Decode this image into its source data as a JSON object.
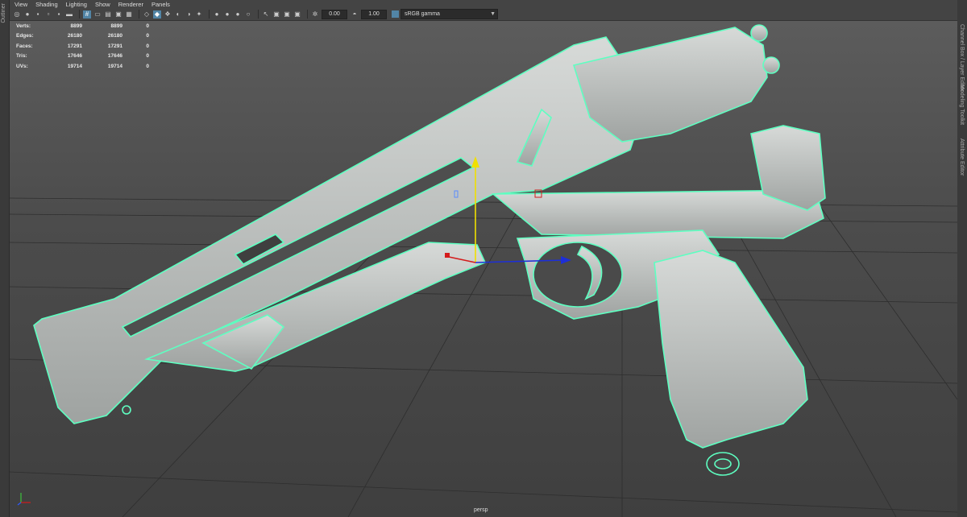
{
  "outliner_label": "Outliner",
  "menubar": [
    "View",
    "Shading",
    "Lighting",
    "Show",
    "Renderer",
    "Panels"
  ],
  "toolbar": {
    "icons": [
      "camera-select-icon",
      "camera-attributes-icon",
      "bookmark-icon",
      "image-plane-icon",
      "grid-icon",
      "film-gate-icon",
      "resolution-gate-icon",
      "gate-mask-icon",
      "field-chart-icon",
      "safe-action-icon",
      "wireframe-icon",
      "smooth-shade-icon",
      "shaded-wireframe-icon",
      "flat-shade-icon",
      "bounding-box-icon",
      "use-lights-icon",
      "shadows-icon",
      "ambient-occlusion-icon",
      "motion-blur-icon",
      "anti-alias-icon",
      "xray-icon",
      "xray-active-icon",
      "xray-joints-icon",
      "isolate-select-icon",
      "exposure-icon"
    ],
    "exposure_value": "0.00",
    "gamma_value": "1.00",
    "color_space": "sRGB gamma"
  },
  "hud": {
    "rows": [
      {
        "label": "Verts:",
        "v1": "8899",
        "v2": "8899",
        "v3": "0"
      },
      {
        "label": "Edges:",
        "v1": "26180",
        "v2": "26180",
        "v3": "0"
      },
      {
        "label": "Faces:",
        "v1": "17291",
        "v2": "17291",
        "v3": "0"
      },
      {
        "label": "Tris:",
        "v1": "17646",
        "v2": "17646",
        "v3": "0"
      },
      {
        "label": "UVs:",
        "v1": "19714",
        "v2": "19714",
        "v3": "0"
      }
    ]
  },
  "camera_label": "persp",
  "right_panel_labels": [
    "Channel Box / Layer Editor",
    "Modeling Toolkit",
    "Attribute Editor"
  ],
  "colors": {
    "wireframe": "#5effc1",
    "mesh": "#b8bcb9",
    "x_axis": "#d41b1b",
    "y_axis": "#f0e000",
    "z_axis": "#1d2fd8"
  }
}
